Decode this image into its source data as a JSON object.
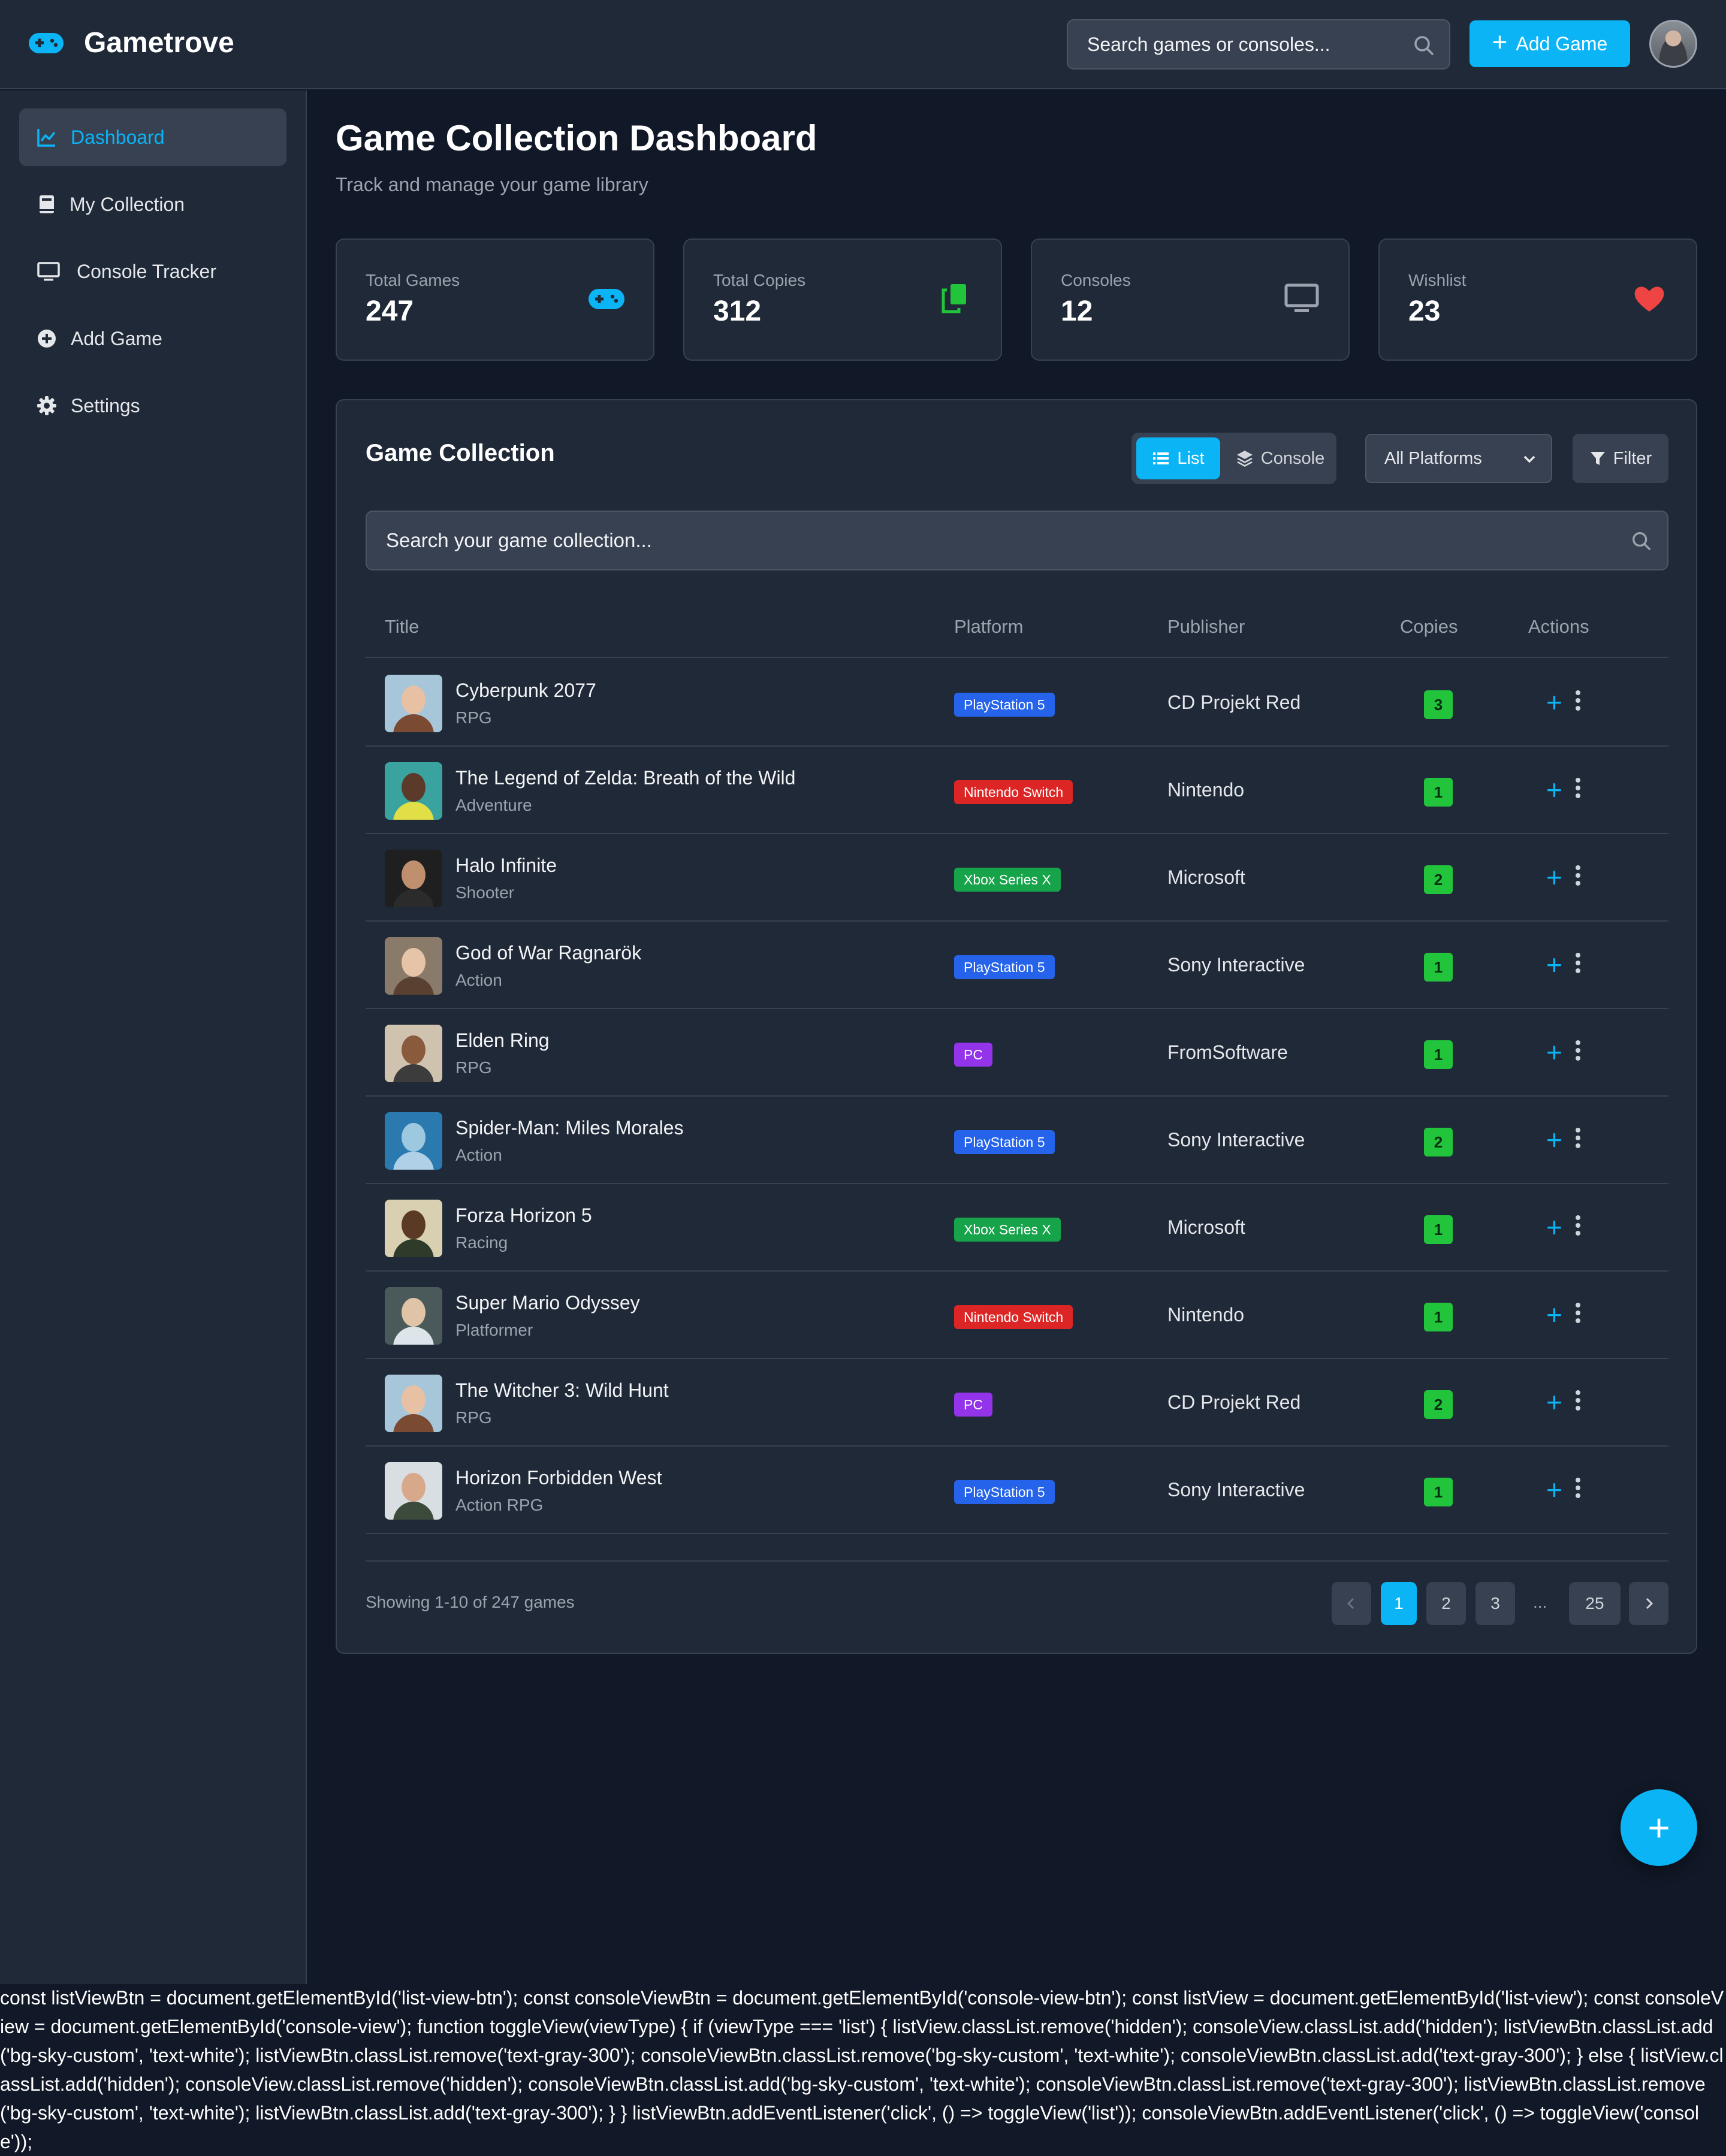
{
  "app": {
    "name": "Gametrove",
    "brand_color": "#0bb4f5"
  },
  "header": {
    "search_placeholder": "Search games or consoles...",
    "add_button_label": "Add Game"
  },
  "sidebar": {
    "items": [
      {
        "label": "Dashboard",
        "icon": "chart-line-icon",
        "active": true
      },
      {
        "label": "My Collection",
        "icon": "book-icon",
        "active": false
      },
      {
        "label": "Console Tracker",
        "icon": "monitor-icon",
        "active": false
      },
      {
        "label": "Add Game",
        "icon": "plus-circle-icon",
        "active": false
      },
      {
        "label": "Settings",
        "icon": "gear-icon",
        "active": false
      }
    ]
  },
  "page": {
    "title": "Game Collection Dashboard",
    "subtitle": "Track and manage your game library"
  },
  "stats": [
    {
      "label": "Total Games",
      "value": "247",
      "icon": "gamepad-icon",
      "color": "#0bb4f5"
    },
    {
      "label": "Total Copies",
      "value": "312",
      "icon": "copy-icon",
      "color": "#21c43a"
    },
    {
      "label": "Consoles",
      "value": "12",
      "icon": "monitor-icon",
      "color": "#9ca3af"
    },
    {
      "label": "Wishlist",
      "value": "23",
      "icon": "heart-icon",
      "color": "#ef4444"
    }
  ],
  "collection": {
    "title": "Game Collection",
    "view_list_label": "List",
    "view_console_label": "Console",
    "platform_filter": "All Platforms",
    "filter_label": "Filter",
    "search_placeholder": "Search your game collection...",
    "columns": [
      "Title",
      "Platform",
      "Publisher",
      "Copies",
      "Actions"
    ],
    "rows": [
      {
        "title": "Cyberpunk 2077",
        "genre": "RPG",
        "platform": "PlayStation 5",
        "publisher": "CD Projekt Red",
        "copies": "3"
      },
      {
        "title": "The Legend of Zelda: Breath of the Wild",
        "genre": "Adventure",
        "platform": "Nintendo Switch",
        "publisher": "Nintendo",
        "copies": "1"
      },
      {
        "title": "Halo Infinite",
        "genre": "Shooter",
        "platform": "Xbox Series X",
        "publisher": "Microsoft",
        "copies": "2"
      },
      {
        "title": "God of War Ragnarök",
        "genre": "Action",
        "platform": "PlayStation 5",
        "publisher": "Sony Interactive",
        "copies": "1"
      },
      {
        "title": "Elden Ring",
        "genre": "RPG",
        "platform": "PC",
        "publisher": "FromSoftware",
        "copies": "1"
      },
      {
        "title": "Spider-Man: Miles Morales",
        "genre": "Action",
        "platform": "PlayStation 5",
        "publisher": "Sony Interactive",
        "copies": "2"
      },
      {
        "title": "Forza Horizon 5",
        "genre": "Racing",
        "platform": "Xbox Series X",
        "publisher": "Microsoft",
        "copies": "1"
      },
      {
        "title": "Super Mario Odyssey",
        "genre": "Platformer",
        "platform": "Nintendo Switch",
        "publisher": "Nintendo",
        "copies": "1"
      },
      {
        "title": "The Witcher 3: Wild Hunt",
        "genre": "RPG",
        "platform": "PC",
        "publisher": "CD Projekt Red",
        "copies": "2"
      },
      {
        "title": "Horizon Forbidden West",
        "genre": "Action RPG",
        "platform": "PlayStation 5",
        "publisher": "Sony Interactive",
        "copies": "1"
      }
    ],
    "platform_colors": {
      "PlayStation 5": "#2563eb",
      "Nintendo Switch": "#dc2626",
      "Xbox Series X": "#16a34a",
      "PC": "#9333ea"
    },
    "showing_text": "Showing 1-10 of 247 games",
    "pages": [
      "1",
      "2",
      "3",
      "...",
      "25"
    ],
    "current_page": "1"
  },
  "raw_script_text": "const listViewBtn = document.getElementById('list-view-btn'); const consoleViewBtn = document.getElementById('console-view-btn'); const listView = document.getElementById('list-view'); const consoleView = document.getElementById('console-view'); function toggleView(viewType) { if (viewType === 'list') { listView.classList.remove('hidden'); consoleView.classList.add('hidden'); listViewBtn.classList.add('bg-sky-custom', 'text-white'); listViewBtn.classList.remove('text-gray-300'); consoleViewBtn.classList.remove('bg-sky-custom', 'text-white'); consoleViewBtn.classList.add('text-gray-300'); } else { listView.classList.add('hidden'); consoleView.classList.remove('hidden'); consoleViewBtn.classList.add('bg-sky-custom', 'text-white'); consoleViewBtn.classList.remove('text-gray-300'); listViewBtn.classList.remove('bg-sky-custom', 'text-white'); listViewBtn.classList.add('text-gray-300'); } } listViewBtn.addEventListener('click', () => toggleView('list')); consoleViewBtn.addEventListener('click', () => toggleView('console'));"
}
